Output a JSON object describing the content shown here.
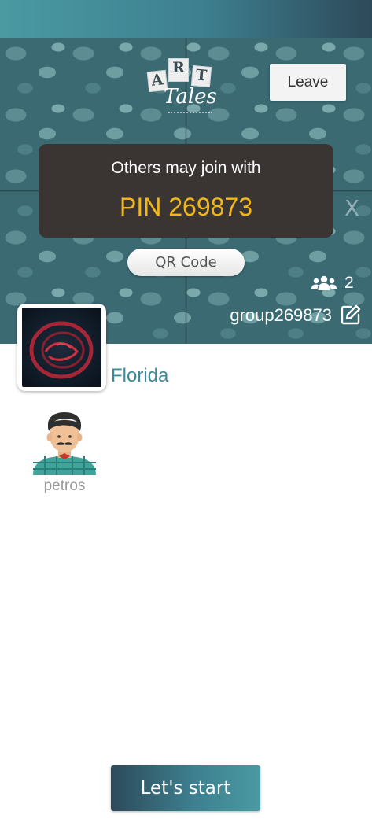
{
  "logo": {
    "letters": [
      "A",
      "R",
      "T"
    ],
    "script": "Tales"
  },
  "header": {
    "leave_label": "Leave"
  },
  "pin_card": {
    "caption": "Others may join with",
    "pin": "PIN 269873"
  },
  "qr_button": {
    "label": "QR Code"
  },
  "group": {
    "member_count": "2",
    "name": "group269873"
  },
  "location": {
    "name": "Florida"
  },
  "players": [
    {
      "name": "petros"
    }
  ],
  "footer": {
    "start_label": "Let's start"
  },
  "colors": {
    "accent_teal": "#3c8a97",
    "pin_gold": "#f2b81b",
    "card_dark": "#3a3533"
  },
  "icons": [
    "users-icon",
    "edit-icon",
    "avatar-icon",
    "artwork-thumbnail"
  ]
}
